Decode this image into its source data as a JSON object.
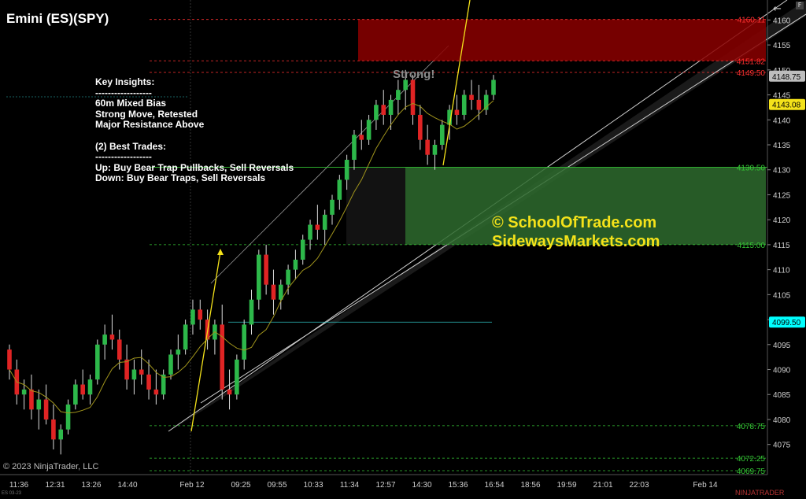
{
  "header": {
    "title": "Emini (ES)(SPY)"
  },
  "toolbar": {
    "back_icon": "arrow-left-icon",
    "f_label": "F"
  },
  "insights": {
    "lines": [
      "Key Insights:",
      "------------------",
      "60m Mixed Bias",
      "Strong Move, Retested",
      "Major Resistance Above",
      "",
      "(2) Best Trades:",
      "------------------",
      "Up: Buy Bear Trap Pullbacks, Sell Reversals",
      "Down: Buy Bear Traps, Sell Reversals"
    ]
  },
  "watermark_text": {
    "line1": "© SchoolOfTrade.com",
    "line2": "SidewaysMarkets.com"
  },
  "annotation_strong": "Strong!",
  "footer": {
    "copyright": "© 2023 NinjaTrader, LLC",
    "brand": "NINJATRADER",
    "chart_id": "ES 03-23"
  },
  "colors": {
    "background": "#000000",
    "up_candle": "#2db84a",
    "down_candle": "#e02424",
    "resistance_zone": "#8b0000",
    "support_zone": "#2e6b2e",
    "ma_line": "#a0941c",
    "trend_line": "#f4e21a",
    "price_last": "#bdbdbd",
    "price_ma": "#f4e21a",
    "price_cyan": "#00ffff"
  },
  "chart_data": {
    "type": "candlestick",
    "title": "Emini (ES)(SPY)",
    "ylim": [
      4069.75,
      4164
    ],
    "y_ticks": [
      4075,
      4080,
      4085,
      4090,
      4095,
      4100,
      4105,
      4110,
      4115,
      4120,
      4125,
      4130,
      4135,
      4140,
      4145,
      4150,
      4155,
      4160
    ],
    "x_ticks": [
      "11:36",
      "12:31",
      "13:26",
      "14:40",
      "Feb 12",
      "09:25",
      "09:55",
      "10:33",
      "11:34",
      "12:57",
      "14:30",
      "15:36",
      "16:54",
      "18:56",
      "19:59",
      "21:01",
      "22:03",
      "Feb 14"
    ],
    "price_levels": [
      {
        "label": "4160.11",
        "value": 4160.11,
        "color": "#ff3030"
      },
      {
        "label": "4151.82",
        "value": 4151.82,
        "color": "#ff3030"
      },
      {
        "label": "4149.50",
        "value": 4149.5,
        "color": "#ff3030"
      },
      {
        "label": "4130.50",
        "value": 4130.5,
        "color": "#34c534"
      },
      {
        "label": "4115.00",
        "value": 4115.0,
        "color": "#34c534"
      },
      {
        "label": "4078.75",
        "value": 4078.75,
        "color": "#34c534"
      },
      {
        "label": "4072.25",
        "value": 4072.25,
        "color": "#34c534"
      },
      {
        "label": "4069.75",
        "value": 4069.75,
        "color": "#34c534"
      }
    ],
    "price_markers": [
      {
        "label": "4148.75",
        "value": 4148.75,
        "bg": "#bdbdbd",
        "fg": "#000000"
      },
      {
        "label": "4143.08",
        "value": 4143.08,
        "bg": "#f4e21a",
        "fg": "#000000"
      },
      {
        "label": "4099.50",
        "value": 4099.5,
        "bg": "#00ffff",
        "fg": "#000000"
      }
    ],
    "zones": [
      {
        "name": "resistance",
        "top": 4160.11,
        "bottom": 4151.82
      },
      {
        "name": "support",
        "top": 4130.5,
        "bottom": 4115.0
      }
    ],
    "candles": [
      [
        4094,
        4095,
        4088,
        4090
      ],
      [
        4090,
        4092,
        4083,
        4085
      ],
      [
        4085,
        4088,
        4082,
        4086
      ],
      [
        4086,
        4089,
        4080,
        4082
      ],
      [
        4082,
        4086,
        4078,
        4084
      ],
      [
        4084,
        4087,
        4079,
        4080
      ],
      [
        4080,
        4083,
        4074,
        4076
      ],
      [
        4076,
        4079,
        4073,
        4078
      ],
      [
        4078,
        4084,
        4077,
        4083
      ],
      [
        4083,
        4088,
        4082,
        4087
      ],
      [
        4087,
        4090,
        4084,
        4085
      ],
      [
        4085,
        4089,
        4083,
        4088
      ],
      [
        4088,
        4096,
        4087,
        4095
      ],
      [
        4095,
        4099,
        4092,
        4097
      ],
      [
        4097,
        4101,
        4094,
        4096
      ],
      [
        4096,
        4098,
        4090,
        4092
      ],
      [
        4092,
        4095,
        4086,
        4088
      ],
      [
        4088,
        4092,
        4085,
        4090
      ],
      [
        4090,
        4094,
        4087,
        4089
      ],
      [
        4089,
        4092,
        4084,
        4086
      ],
      [
        4086,
        4090,
        4083,
        4085
      ],
      [
        4085,
        4090,
        4084,
        4089
      ],
      [
        4089,
        4094,
        4088,
        4093
      ],
      [
        4093,
        4097,
        4090,
        4094
      ],
      [
        4094,
        4100,
        4093,
        4099
      ],
      [
        4099,
        4104,
        4097,
        4102
      ],
      [
        4102,
        4104,
        4098,
        4100
      ],
      [
        4100,
        4102,
        4094,
        4096
      ],
      [
        4096,
        4100,
        4093,
        4099
      ],
      [
        4099,
        4103,
        4084,
        4086
      ],
      [
        4086,
        4090,
        4082,
        4085
      ],
      [
        4085,
        4093,
        4084,
        4092
      ],
      [
        4092,
        4100,
        4090,
        4099
      ],
      [
        4099,
        4106,
        4097,
        4104
      ],
      [
        4104,
        4114,
        4102,
        4113
      ],
      [
        4113,
        4115,
        4105,
        4107
      ],
      [
        4107,
        4110,
        4101,
        4104
      ],
      [
        4104,
        4108,
        4102,
        4107
      ],
      [
        4107,
        4111,
        4105,
        4110
      ],
      [
        4110,
        4114,
        4108,
        4112
      ],
      [
        4112,
        4117,
        4111,
        4116
      ],
      [
        4116,
        4120,
        4114,
        4119
      ],
      [
        4119,
        4123,
        4116,
        4118
      ],
      [
        4118,
        4122,
        4115,
        4121
      ],
      [
        4121,
        4125,
        4119,
        4124
      ],
      [
        4124,
        4129,
        4122,
        4128
      ],
      [
        4128,
        4133,
        4126,
        4132
      ],
      [
        4132,
        4138,
        4130,
        4137
      ],
      [
        4137,
        4140,
        4134,
        4136
      ],
      [
        4136,
        4141,
        4135,
        4140
      ],
      [
        4140,
        4144,
        4138,
        4143
      ],
      [
        4143,
        4146,
        4139,
        4141
      ],
      [
        4141,
        4145,
        4138,
        4144
      ],
      [
        4144,
        4148,
        4141,
        4146
      ],
      [
        4146,
        4150,
        4142,
        4148
      ],
      [
        4148,
        4149,
        4139,
        4141
      ],
      [
        4141,
        4143,
        4134,
        4136
      ],
      [
        4136,
        4139,
        4131,
        4133
      ],
      [
        4133,
        4136,
        4130,
        4135
      ],
      [
        4135,
        4140,
        4134,
        4139
      ],
      [
        4139,
        4143,
        4136,
        4142
      ],
      [
        4142,
        4145,
        4139,
        4141
      ],
      [
        4141,
        4146,
        4140,
        4145
      ],
      [
        4145,
        4148,
        4142,
        4144
      ],
      [
        4144,
        4147,
        4140,
        4142
      ],
      [
        4142,
        4146,
        4141,
        4145
      ],
      [
        4145,
        4149,
        4144,
        4148
      ]
    ],
    "series": [
      {
        "name": "",
        "type": "moving-average"
      },
      {
        "name": "",
        "type": "regression-channel"
      }
    ]
  }
}
